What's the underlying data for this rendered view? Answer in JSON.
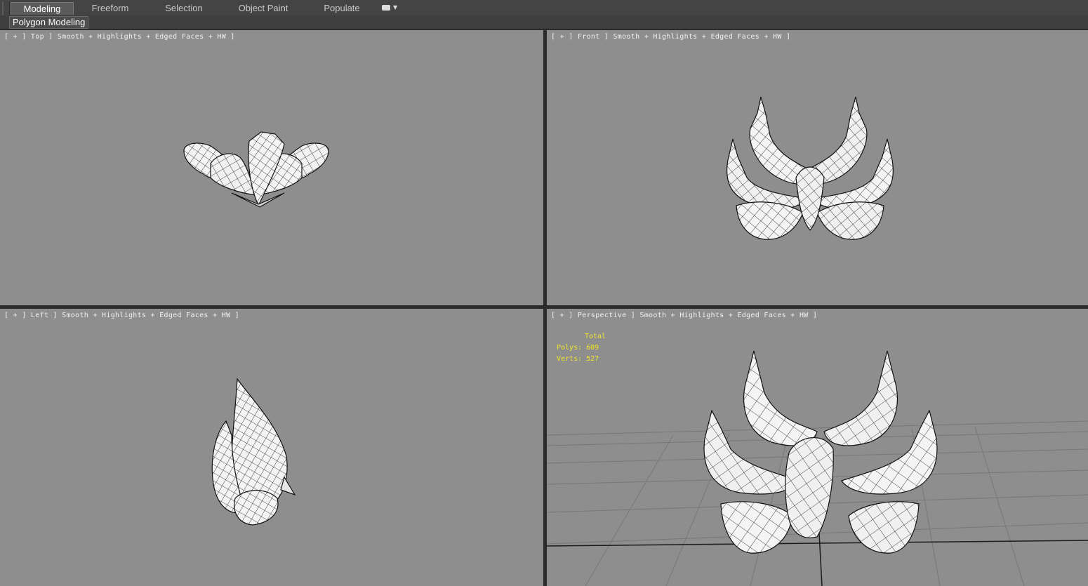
{
  "ribbon": {
    "tabs": [
      {
        "label": "Modeling",
        "active": true
      },
      {
        "label": "Freeform",
        "active": false
      },
      {
        "label": "Selection",
        "active": false
      },
      {
        "label": "Object Paint",
        "active": false
      },
      {
        "label": "Populate",
        "active": false
      }
    ],
    "dropdown_icon": "ribbon-options-icon",
    "panel_label": "Polygon Modeling"
  },
  "viewports": {
    "top": {
      "label": "[ + ] Top ] Smooth + Highlights + Edged Faces + HW ]"
    },
    "front": {
      "label": "[ + ] Front ] Smooth + Highlights + Edged Faces + HW ]"
    },
    "left": {
      "label": "[ + ] Left ] Smooth + Highlights + Edged Faces + HW ]"
    },
    "perspective": {
      "label": "[ + ] Perspective ] Smooth + Highlights + Edged Faces + HW ]",
      "stats": {
        "title": "Total",
        "polys": "Polys: 609",
        "verts": "Verts: 527"
      }
    }
  },
  "colors": {
    "viewport_bg": "#8e8e8e",
    "stats_text": "#f2e52a",
    "active_tab": "#5b5b5b",
    "mesh_fill": "#f4f4f4",
    "mesh_edge": "#111111"
  }
}
